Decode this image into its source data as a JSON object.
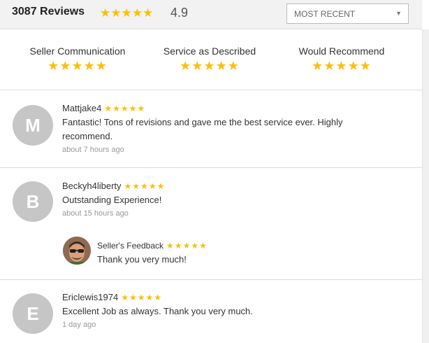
{
  "header": {
    "review_count": "3087 Reviews",
    "stars": "★★★★★",
    "score": "4.9",
    "sort_label": "MOST RECENT"
  },
  "ratings": [
    {
      "name": "Seller Communication",
      "stars": "★★★★★"
    },
    {
      "name": "Service as Described",
      "stars": "★★★★★"
    },
    {
      "name": "Would Recommend",
      "stars": "★★★★★"
    }
  ],
  "reviews": [
    {
      "initial": "M",
      "username": "Mattjake4",
      "stars": "★★★★★",
      "text": "Fantastic! Tons of revisions and gave me the best service ever. Highly recommend.",
      "time": "about 7 hours ago"
    },
    {
      "initial": "B",
      "username": "Beckyh4liberty",
      "stars": "★★★★★",
      "text": "Outstanding Experience!",
      "time": "about 15 hours ago",
      "seller_feedback": {
        "label": "Seller's Feedback",
        "stars": "★★★★★",
        "text": "Thank you very much!"
      }
    },
    {
      "initial": "E",
      "username": "Ericlewis1974",
      "stars": "★★★★★",
      "text": "Excellent Job as always. Thank you very much.",
      "time": "1 day ago"
    }
  ],
  "colors": {
    "star": "#ffbe00",
    "avatar_bg": "#c6c6c6"
  }
}
